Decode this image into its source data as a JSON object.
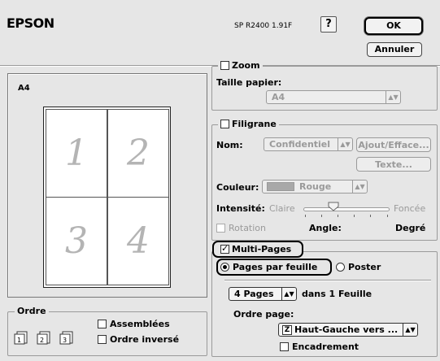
{
  "header": {
    "brand": "EPSON",
    "version": "SP R2400 1.91F",
    "help_label": "?",
    "ok_label": "OK",
    "cancel_label": "Annuler"
  },
  "preview": {
    "paper_label": "A4",
    "pages": [
      "1",
      "2",
      "3",
      "4"
    ]
  },
  "zoom": {
    "label": "Zoom",
    "checked": false,
    "paper_size_label": "Taille papier:",
    "paper_size_value": "A4"
  },
  "watermark": {
    "label": "Filigrane",
    "checked": false,
    "name_label": "Nom:",
    "name_value": "Confidentiel",
    "add_remove_label": "Ajout/Efface...",
    "text_label": "Texte...",
    "color_label": "Couleur:",
    "color_value": "Rouge",
    "intensity_label": "Intensité:",
    "intensity_low": "Claire",
    "intensity_high": "Foncée",
    "intensity_value": 0.35,
    "rotation_label": "Rotation",
    "angle_label": "Angle:",
    "degree_label": "Degré"
  },
  "multipage": {
    "label": "Multi-Pages",
    "checked": true,
    "pages_per_sheet_label": "Pages par feuille",
    "poster_label": "Poster",
    "pages_value": "4 Pages",
    "per_sheet_suffix": "dans 1 Feuille",
    "page_order_label": "Ordre page:",
    "page_order_value": "Haut-Gauche vers ...",
    "border_label": "Encadrement"
  },
  "order": {
    "label": "Ordre",
    "collated_label": "Assemblées",
    "reverse_label": "Ordre inversé"
  },
  "colors": {
    "background": "#e6e6e6",
    "watermark_swatch": "#a8a8a8"
  }
}
